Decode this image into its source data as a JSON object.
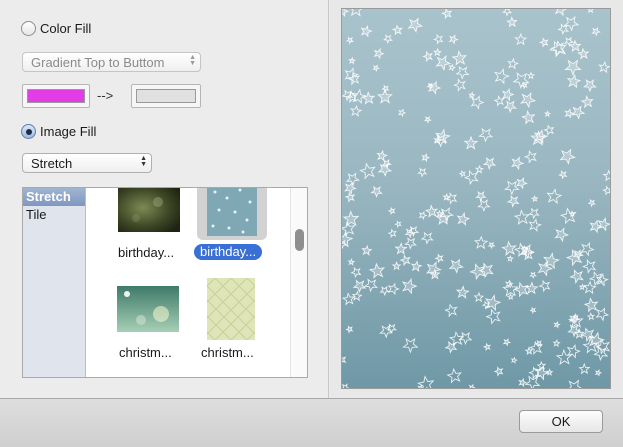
{
  "color_fill": {
    "label": "Color Fill",
    "checked": false
  },
  "gradient_select": {
    "value": "Gradient Top to Buttom"
  },
  "colors": {
    "start_color": "#e23ce6",
    "arrow_text": "-->",
    "end_color": "#e0e0e0"
  },
  "image_fill": {
    "label": "Image Fill",
    "checked": true
  },
  "mode_select": {
    "value": "Stretch"
  },
  "mode_list": {
    "items": [
      "Stretch",
      "Tile"
    ],
    "selected": "Stretch"
  },
  "thumbnails": [
    {
      "label": "birthday...",
      "selected": false,
      "icon": "birthday-dark-bokeh-thumbnail"
    },
    {
      "label": "birthday...",
      "selected": true,
      "icon": "birthday-blue-stars-thumbnail"
    },
    {
      "label": "christm...",
      "selected": false,
      "icon": "christmas-green-thumbnail"
    },
    {
      "label": "christm...",
      "selected": false,
      "icon": "christmas-cream-pattern-thumbnail"
    }
  ],
  "footer": {
    "ok_label": "OK"
  },
  "colors_theme": {
    "accent": "#3a6fd6",
    "preview_base": "#8fb1bc"
  }
}
